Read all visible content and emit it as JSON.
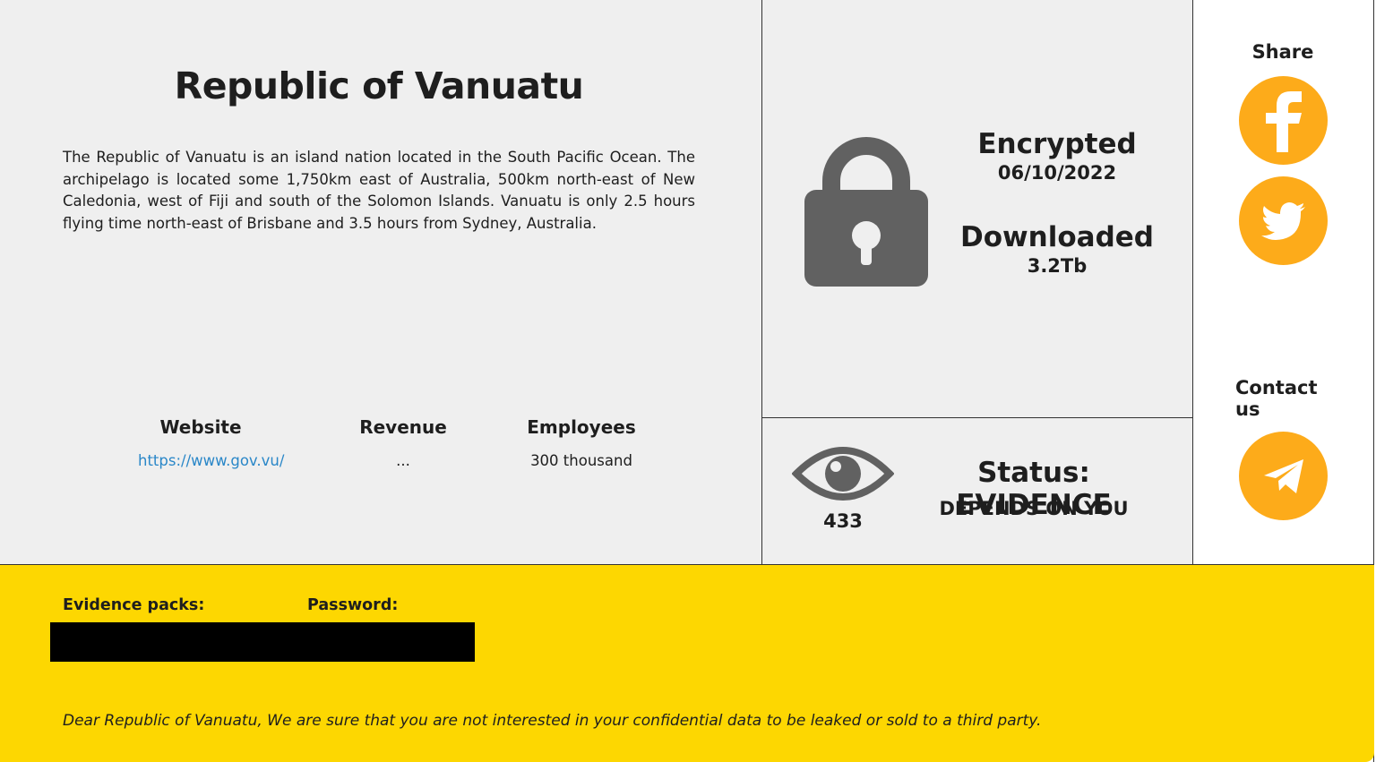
{
  "victim": {
    "title": "Republic of Vanuatu",
    "description": "The Republic of Vanuatu is an island nation located in the South Pacific Ocean. The archipelago is located some 1,750km east of Australia, 500km north-east of New Caledonia, west of Fiji and south of the Solomon Islands. Vanuatu is only 2.5 hours flying time north-east of Brisbane and 3.5 hours from Sydney, Australia.",
    "info": {
      "website_label": "Website",
      "website_value": "https://www.gov.vu/",
      "revenue_label": "Revenue",
      "revenue_value": "...",
      "employees_label": "Employees",
      "employees_value": "300 thousand"
    }
  },
  "stats": {
    "encrypted_label": "Encrypted",
    "encrypted_date": "06/10/2022",
    "downloaded_label": "Downloaded",
    "downloaded_size": "3.2Tb"
  },
  "status": {
    "views": "433",
    "title": "Status: EVIDENCE",
    "subtitle": "DEPENDS ON YOU"
  },
  "share": {
    "label": "Share",
    "facebook_icon": "facebook-icon",
    "twitter_icon": "twitter-icon"
  },
  "contact": {
    "label": "Contact us",
    "telegram_icon": "telegram-icon"
  },
  "evidence": {
    "packs_label": "Evidence packs:",
    "password_label": "Password:"
  },
  "message": "Dear Republic of Vanuatu, We are sure that you are not interested in your confidential data to be leaked or sold to a third party.",
  "colors": {
    "accent_orange": "#fdab1a",
    "band_yellow": "#fdd701",
    "panel_gray": "#efefef",
    "link_blue": "#2a87c8",
    "icon_gray": "#616161"
  }
}
